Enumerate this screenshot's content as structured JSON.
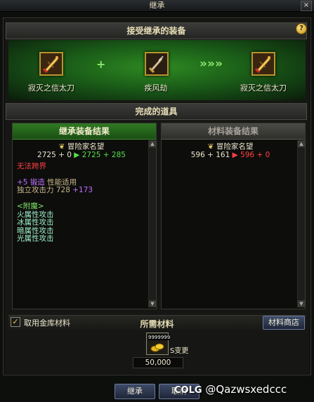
{
  "window": {
    "title": "继承",
    "close": "×"
  },
  "section_equipment": {
    "title": "接受继承的装备",
    "help": "?"
  },
  "banner": {
    "left_item": "寂灭之信太刀",
    "plus": "+",
    "mid_item": "疾风劫",
    "arrows": "»»»",
    "right_item": "寂灭之信太刀"
  },
  "section_result": {
    "title": "完成的道具"
  },
  "result_panel": {
    "title": "继承装备结果",
    "badge_label": "冒险家名望",
    "fame_before": "2725 + 0",
    "fame_after": "2725 + 285",
    "unavailable": "无法跨界",
    "forge_level": "+5",
    "forge_label": "锻造",
    "forge_note": "性能适用",
    "indep_attack_label": "独立攻击力 728",
    "indep_attack_bonus": "+173",
    "enchant_header": "<附魔>",
    "enchant_lines": [
      "火属性攻击",
      "冰属性攻击",
      "暗属性攻击",
      "光属性攻击"
    ]
  },
  "material_panel": {
    "title": "材料装备结果",
    "badge_label": "冒险家名望",
    "fame_before": "596 + 161",
    "fame_after": "596 + 0"
  },
  "materials": {
    "use_storage_label": "取用金库材料",
    "use_storage_checked": true,
    "header": "所需材料",
    "shop_button": "材料商店",
    "item_quantity": "9999999",
    "item_suffix": "S变更",
    "cost": "50,000"
  },
  "buttons": {
    "confirm": "继承",
    "cancel": "取消"
  },
  "watermark": {
    "brand": "COLG",
    "handle": "@Qazwsxedccc"
  },
  "colors": {
    "accent_green": "#55e04a",
    "accent_red": "#ff4040",
    "gold": "#b8952c"
  }
}
